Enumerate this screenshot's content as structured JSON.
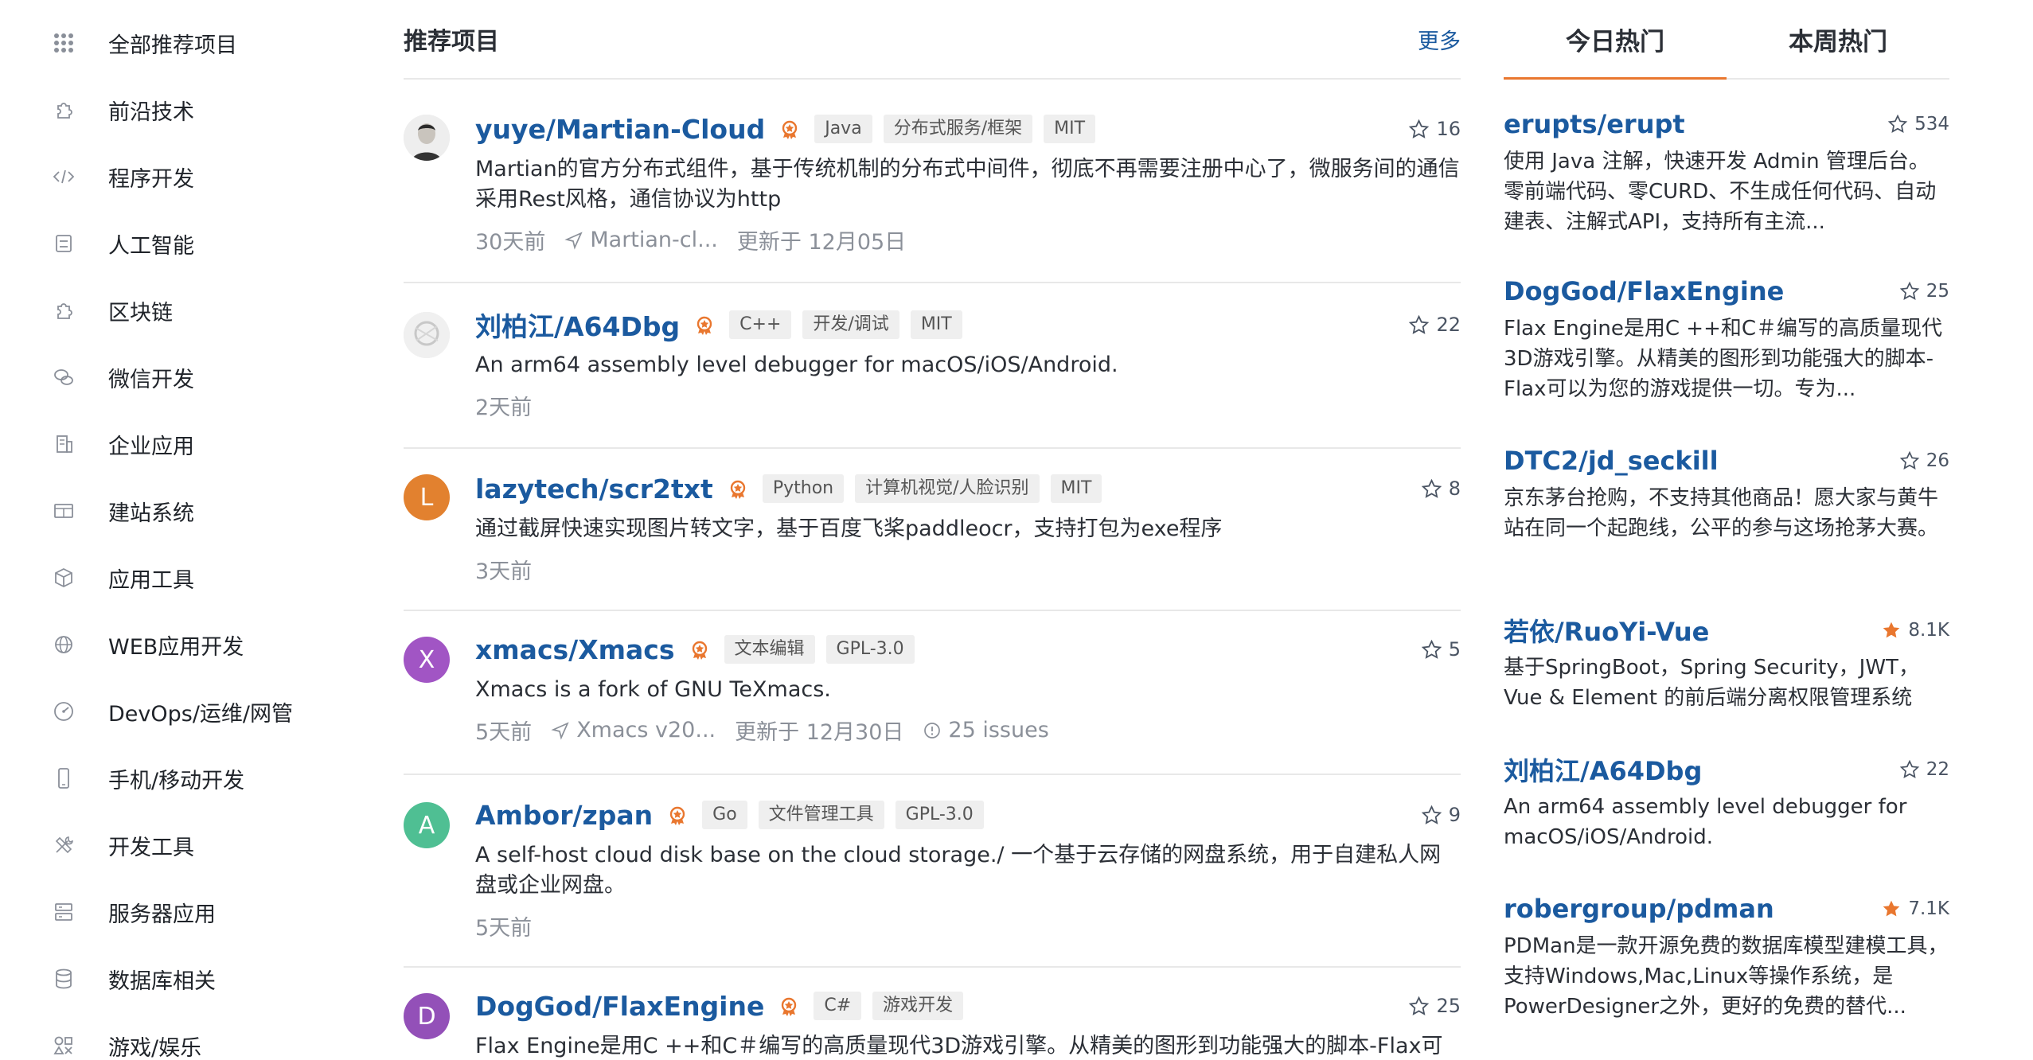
{
  "sidebar": {
    "items": [
      {
        "label": "全部推荐项目",
        "icon": "grid-icon"
      },
      {
        "label": "前沿技术",
        "icon": "puzzle-icon"
      },
      {
        "label": "程序开发",
        "icon": "code-icon"
      },
      {
        "label": "人工智能",
        "icon": "robot-icon"
      },
      {
        "label": "区块链",
        "icon": "puzzle-icon"
      },
      {
        "label": "微信开发",
        "icon": "chat-icon"
      },
      {
        "label": "企业应用",
        "icon": "building-icon"
      },
      {
        "label": "建站系统",
        "icon": "layout-icon"
      },
      {
        "label": "应用工具",
        "icon": "cube-icon"
      },
      {
        "label": "WEB应用开发",
        "icon": "globe-icon"
      },
      {
        "label": "DevOps/运维/网管",
        "icon": "gauge-icon"
      },
      {
        "label": "手机/移动开发",
        "icon": "phone-icon"
      },
      {
        "label": "开发工具",
        "icon": "tools-icon"
      },
      {
        "label": "服务器应用",
        "icon": "server-icon"
      },
      {
        "label": "数据库相关",
        "icon": "database-icon"
      },
      {
        "label": "游戏/娱乐",
        "icon": "game-icon"
      }
    ]
  },
  "main": {
    "title": "推荐项目",
    "more": "更多",
    "projects": [
      {
        "name": "yuye/Martian-Cloud",
        "tags": [
          "Java",
          "分布式服务/框架",
          "MIT"
        ],
        "stars": "16",
        "desc": "Martian的官方分布式组件，基于传统机制的分布式中间件，彻底不再需要注册中心了，微服务间的通信采用Rest风格，通信协议为http",
        "time": "30天前",
        "commit": "Martian-cl...",
        "updated": "更新于 12月05日",
        "issues": ""
      },
      {
        "name": "刘柏江/A64Dbg",
        "tags": [
          "C++",
          "开发/调试",
          "MIT"
        ],
        "stars": "22",
        "desc": "An arm64 assembly level debugger for macOS/iOS/Android.",
        "time": "2天前",
        "commit": "",
        "updated": "",
        "issues": ""
      },
      {
        "name": "lazytech/scr2txt",
        "avatar_letter": "L",
        "avatar_color": "#e2812f",
        "tags": [
          "Python",
          "计算机视觉/人脸识别",
          "MIT"
        ],
        "stars": "8",
        "desc": "通过截屏快速实现图片转文字，基于百度飞桨paddleocr，支持打包为exe程序",
        "time": "3天前",
        "commit": "",
        "updated": "",
        "issues": ""
      },
      {
        "name": "xmacs/Xmacs",
        "avatar_letter": "X",
        "avatar_color": "#a155c4",
        "tags": [
          "文本编辑",
          "GPL-3.0"
        ],
        "stars": "5",
        "desc": "Xmacs is a fork of GNU TeXmacs.",
        "time": "5天前",
        "commit": "Xmacs v20...",
        "updated": "更新于 12月30日",
        "issues": "25 issues"
      },
      {
        "name": "Ambor/zpan",
        "avatar_letter": "A",
        "avatar_color": "#4fbf93",
        "tags": [
          "Go",
          "文件管理工具",
          "GPL-3.0"
        ],
        "stars": "9",
        "desc": "A self-host cloud disk base on the cloud storage./ 一个基于云存储的网盘系统，用于自建私人网盘或企业网盘。",
        "time": "5天前",
        "commit": "",
        "updated": "",
        "issues": ""
      },
      {
        "name": "DogGod/FlaxEngine",
        "avatar_letter": "D",
        "avatar_color": "#9350b8",
        "tags": [
          "C#",
          "游戏开发"
        ],
        "stars": "25",
        "desc": "Flax Engine是用C ++和C＃编写的高质量现代3D游戏引擎。从精美的图形到功能强大的脚本-Flax可",
        "time": "",
        "commit": "",
        "updated": "",
        "issues": ""
      }
    ]
  },
  "hot": {
    "tabs": [
      "今日热门",
      "本周热门"
    ],
    "items": [
      {
        "name": "erupts/erupt",
        "stars": "534",
        "filled": false,
        "desc": "使用 Java 注解，快速开发 Admin 管理后台。零前端代码、零CURD、不生成任何代码、自动建表、注解式API，支持所有主流..."
      },
      {
        "name": "DogGod/FlaxEngine",
        "stars": "25",
        "filled": false,
        "desc": "Flax Engine是用C ++和C＃编写的高质量现代3D游戏引擎。从精美的图形到功能强大的脚本-Flax可以为您的游戏提供一切。专为..."
      },
      {
        "name": "DTC2/jd_seckill",
        "stars": "26",
        "filled": false,
        "desc": "京东茅台抢购，不支持其他商品！愿大家与黄牛站在同一个起跑线，公平的参与这场抢茅大赛。"
      },
      {
        "name": "若依/RuoYi-Vue",
        "stars": "8.1K",
        "filled": true,
        "desc": "基于SpringBoot，Spring Security，JWT，Vue & Element 的前后端分离权限管理系统"
      },
      {
        "name": "刘柏江/A64Dbg",
        "stars": "22",
        "filled": false,
        "desc": "An arm64 assembly level debugger for macOS/iOS/Android."
      },
      {
        "name": "robergroup/pdman",
        "stars": "7.1K",
        "filled": true,
        "desc": "PDMan是一款开源免费的数据库模型建模工具，支持Windows,Mac,Linux等操作系统，是PowerDesigner之外，更好的免费的替代..."
      }
    ]
  },
  "colors": {
    "link": "#1b5a9f",
    "accent": "#e9772f"
  }
}
